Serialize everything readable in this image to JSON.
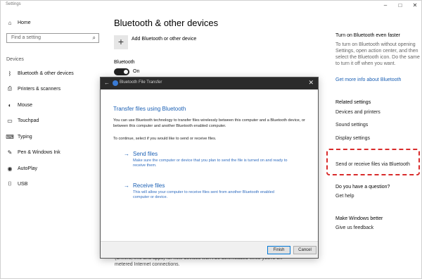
{
  "window": {
    "title": "Settings",
    "controls": [
      "–",
      "□",
      "✕"
    ]
  },
  "nav": {
    "home": "Home",
    "search_placeholder": "Find a setting",
    "section": "Devices",
    "items": [
      {
        "label": "Bluetooth & other devices",
        "icon": "bluetooth-icon",
        "glyph": "ᛒ"
      },
      {
        "label": "Printers & scanners",
        "icon": "printer-icon",
        "glyph": "⎙"
      },
      {
        "label": "Mouse",
        "icon": "mouse-icon",
        "glyph": "◐"
      },
      {
        "label": "Touchpad",
        "icon": "touchpad-icon",
        "glyph": "▭"
      },
      {
        "label": "Typing",
        "icon": "keyboard-icon",
        "glyph": "⌨"
      },
      {
        "label": "Pen & Windows Ink",
        "icon": "pen-icon",
        "glyph": "✎"
      },
      {
        "label": "AutoPlay",
        "icon": "autoplay-icon",
        "glyph": "◉"
      },
      {
        "label": "USB",
        "icon": "usb-icon",
        "glyph": "⌷"
      }
    ]
  },
  "main": {
    "title": "Bluetooth & other devices",
    "add_label": "Add Bluetooth or other device",
    "bluetooth_label": "Bluetooth",
    "toggle_state": "On",
    "bottom_note": "(drivers, info and apps) for new devices won't be downloaded while you're on metered Internet connections."
  },
  "right": {
    "tip_heading": "Turn on Bluetooth even faster",
    "tip_body": "To turn on Bluetooth without opening Settings, open action center, and then select the Bluetooth icon. Do the same to turn it off when you want.",
    "tip_link": "Get more info about Bluetooth",
    "related_heading": "Related settings",
    "related": [
      "Devices and printers",
      "Sound settings",
      "Display settings",
      "Send or receive files via Bluetooth"
    ],
    "question_heading": "Do you have a question?",
    "question_link": "Get help",
    "better_heading": "Make Windows better",
    "better_link": "Give us feedback"
  },
  "dialog": {
    "title": "Bluetooth File Transfer",
    "heading": "Transfer files using Bluetooth",
    "intro": "You can use Bluetooth technology to transfer files wirelessly between this computer and a Bluetooth device, or between this computer and another Bluetooth enabled computer.",
    "question": "To continue, select if you would like to send or receive files.",
    "options": [
      {
        "title": "Send files",
        "desc": "Make sure the computer or device that you plan to send the file is turned on and ready to receive them."
      },
      {
        "title": "Receive files",
        "desc": "This will allow your computer to receive files sent from another Bluetooth enabled computer or device."
      }
    ],
    "finish_label": "Finish",
    "cancel_label": "Cancel"
  }
}
